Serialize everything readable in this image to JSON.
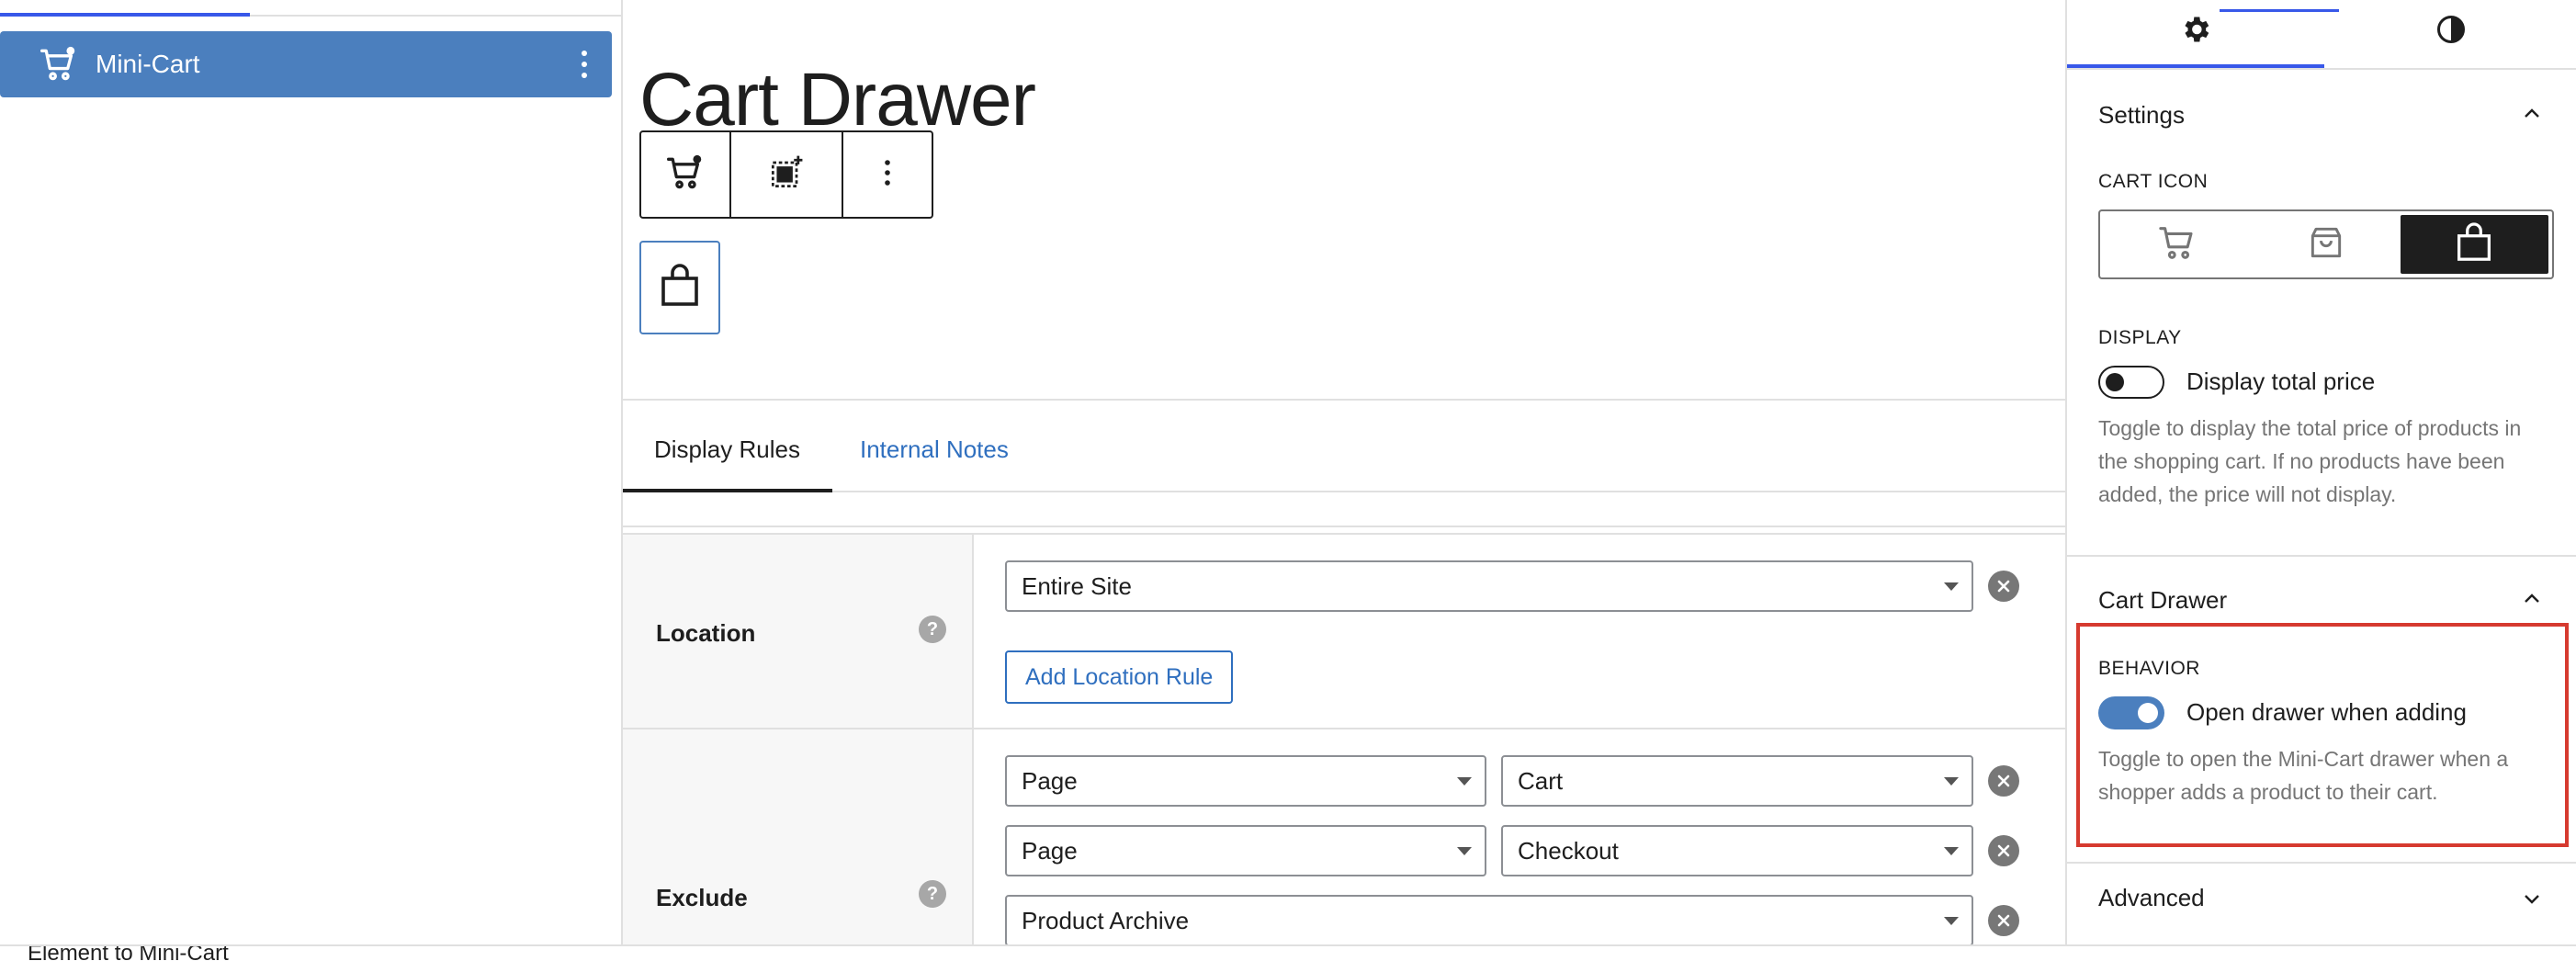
{
  "list_view": {
    "item_label": "Mini-Cart"
  },
  "canvas": {
    "title": "Cart Drawer",
    "tabs": [
      {
        "label": "Display Rules",
        "active": true
      },
      {
        "label": "Internal Notes",
        "active": false
      }
    ],
    "rules": {
      "location_label": "Location",
      "location_select": "Entire Site",
      "add_location_rule": "Add Location Rule",
      "exclude_label": "Exclude",
      "exclude_rows": [
        {
          "type": "Page",
          "value": "Cart"
        },
        {
          "type": "Page",
          "value": "Checkout"
        },
        {
          "type": "Product Archive"
        }
      ],
      "help_glyph": "?"
    }
  },
  "sidebar": {
    "settings_header": "Settings",
    "cart_icon_label": "CART ICON",
    "cart_icon_options": [
      "cart-icon",
      "bag-icon",
      "bag-alt-icon"
    ],
    "cart_icon_selected": 2,
    "display_label": "DISPLAY",
    "display_toggle_label": "Display total price",
    "display_toggle_on": false,
    "display_help": "Toggle to display the total price of products in the shopping cart. If no products have been added, the price will not display.",
    "cart_drawer_header": "Cart Drawer",
    "behavior_label": "BEHAVIOR",
    "behavior_toggle_label": "Open drawer when adding",
    "behavior_toggle_on": true,
    "behavior_help": "Toggle to open the Mini-Cart drawer when a shopper adds a product to their cart.",
    "advanced_header": "Advanced"
  },
  "colors": {
    "accent": "#4b7fbe",
    "admin_blue": "#3858e9",
    "link": "#2f6fbf",
    "highlight": "#d63a2f"
  },
  "status_bar": {
    "text": "Element to Mini-Cart"
  }
}
